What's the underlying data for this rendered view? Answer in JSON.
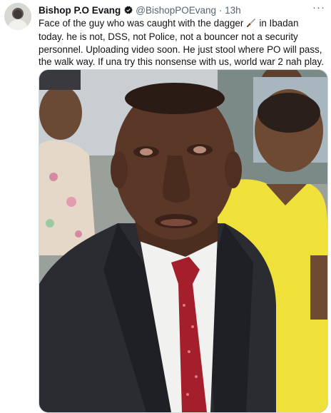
{
  "tweet": {
    "author_name": "Bishop P.O Evang",
    "handle": "@BishopPOEvang",
    "separator": "·",
    "timestamp": "13h",
    "more_label": "···",
    "text_part1": "Face of the guy who was caught with the dagger",
    "dagger_icon": "dagger-icon",
    "text_part2": "in Ibadan today. he is not, DSS, not Police, not a bouncer not a security personnel. Uploading video soon. He just stool where PO will pass, the walk way. If una try this nonsense with us, world war 2 nah play.",
    "verified_icon": "verified-badge-icon",
    "avatar_icon": "profile-avatar"
  },
  "colors": {
    "text_primary": "#0f1419",
    "text_secondary": "#536471",
    "border": "#cfd9de"
  }
}
